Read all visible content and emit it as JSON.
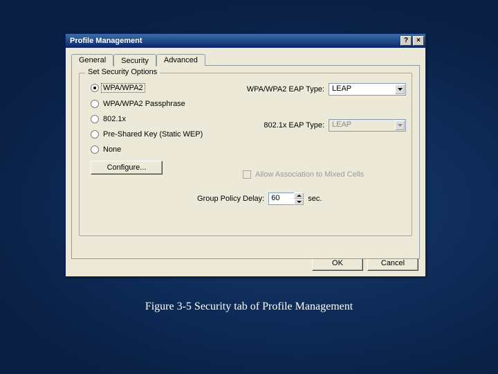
{
  "window": {
    "title": "Profile Management",
    "help_btn": "?",
    "close_btn": "×"
  },
  "tabs": {
    "general": "General",
    "security": "Security",
    "advanced": "Advanced",
    "active_index": 1
  },
  "group": {
    "legend": "Set Security Options"
  },
  "radios": [
    {
      "label": "WPA/WPA2",
      "selected": true
    },
    {
      "label": "WPA/WPA2 Passphrase",
      "selected": false
    },
    {
      "label": "802.1x",
      "selected": false
    },
    {
      "label": "Pre-Shared Key (Static WEP)",
      "selected": false
    },
    {
      "label": "None",
      "selected": false
    }
  ],
  "configure_label": "Configure...",
  "fields": {
    "wpa_eap": {
      "label": "WPA/WPA2 EAP Type:",
      "value": "LEAP",
      "enabled": true
    },
    "dot1x_eap": {
      "label": "802.1x EAP Type:",
      "value": "LEAP",
      "enabled": false
    }
  },
  "checkbox": {
    "label": "Allow Association to Mixed Cells",
    "checked": false,
    "enabled": false
  },
  "gpd": {
    "label": "Group Policy Delay:",
    "value": "60",
    "unit": "sec."
  },
  "buttons": {
    "ok": "OK",
    "cancel": "Cancel"
  },
  "caption": "Figure 3-5 Security tab of Profile Management"
}
